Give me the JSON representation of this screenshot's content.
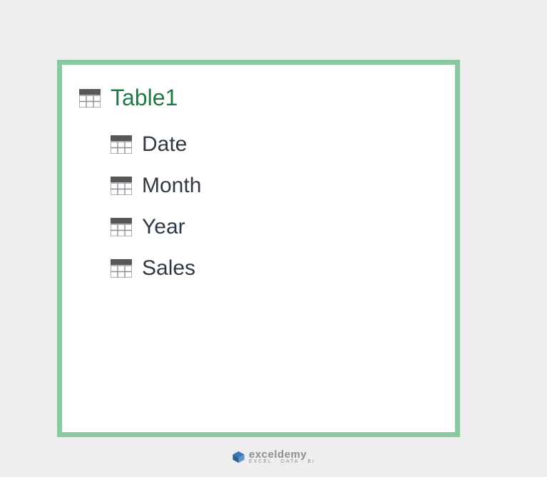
{
  "panel": {
    "table_name": "Table1",
    "fields": [
      {
        "label": "Date"
      },
      {
        "label": "Month"
      },
      {
        "label": "Year"
      },
      {
        "label": "Sales"
      }
    ]
  },
  "watermark": {
    "brand": "exceldemy",
    "tagline": "EXCEL · DATA · BI"
  }
}
